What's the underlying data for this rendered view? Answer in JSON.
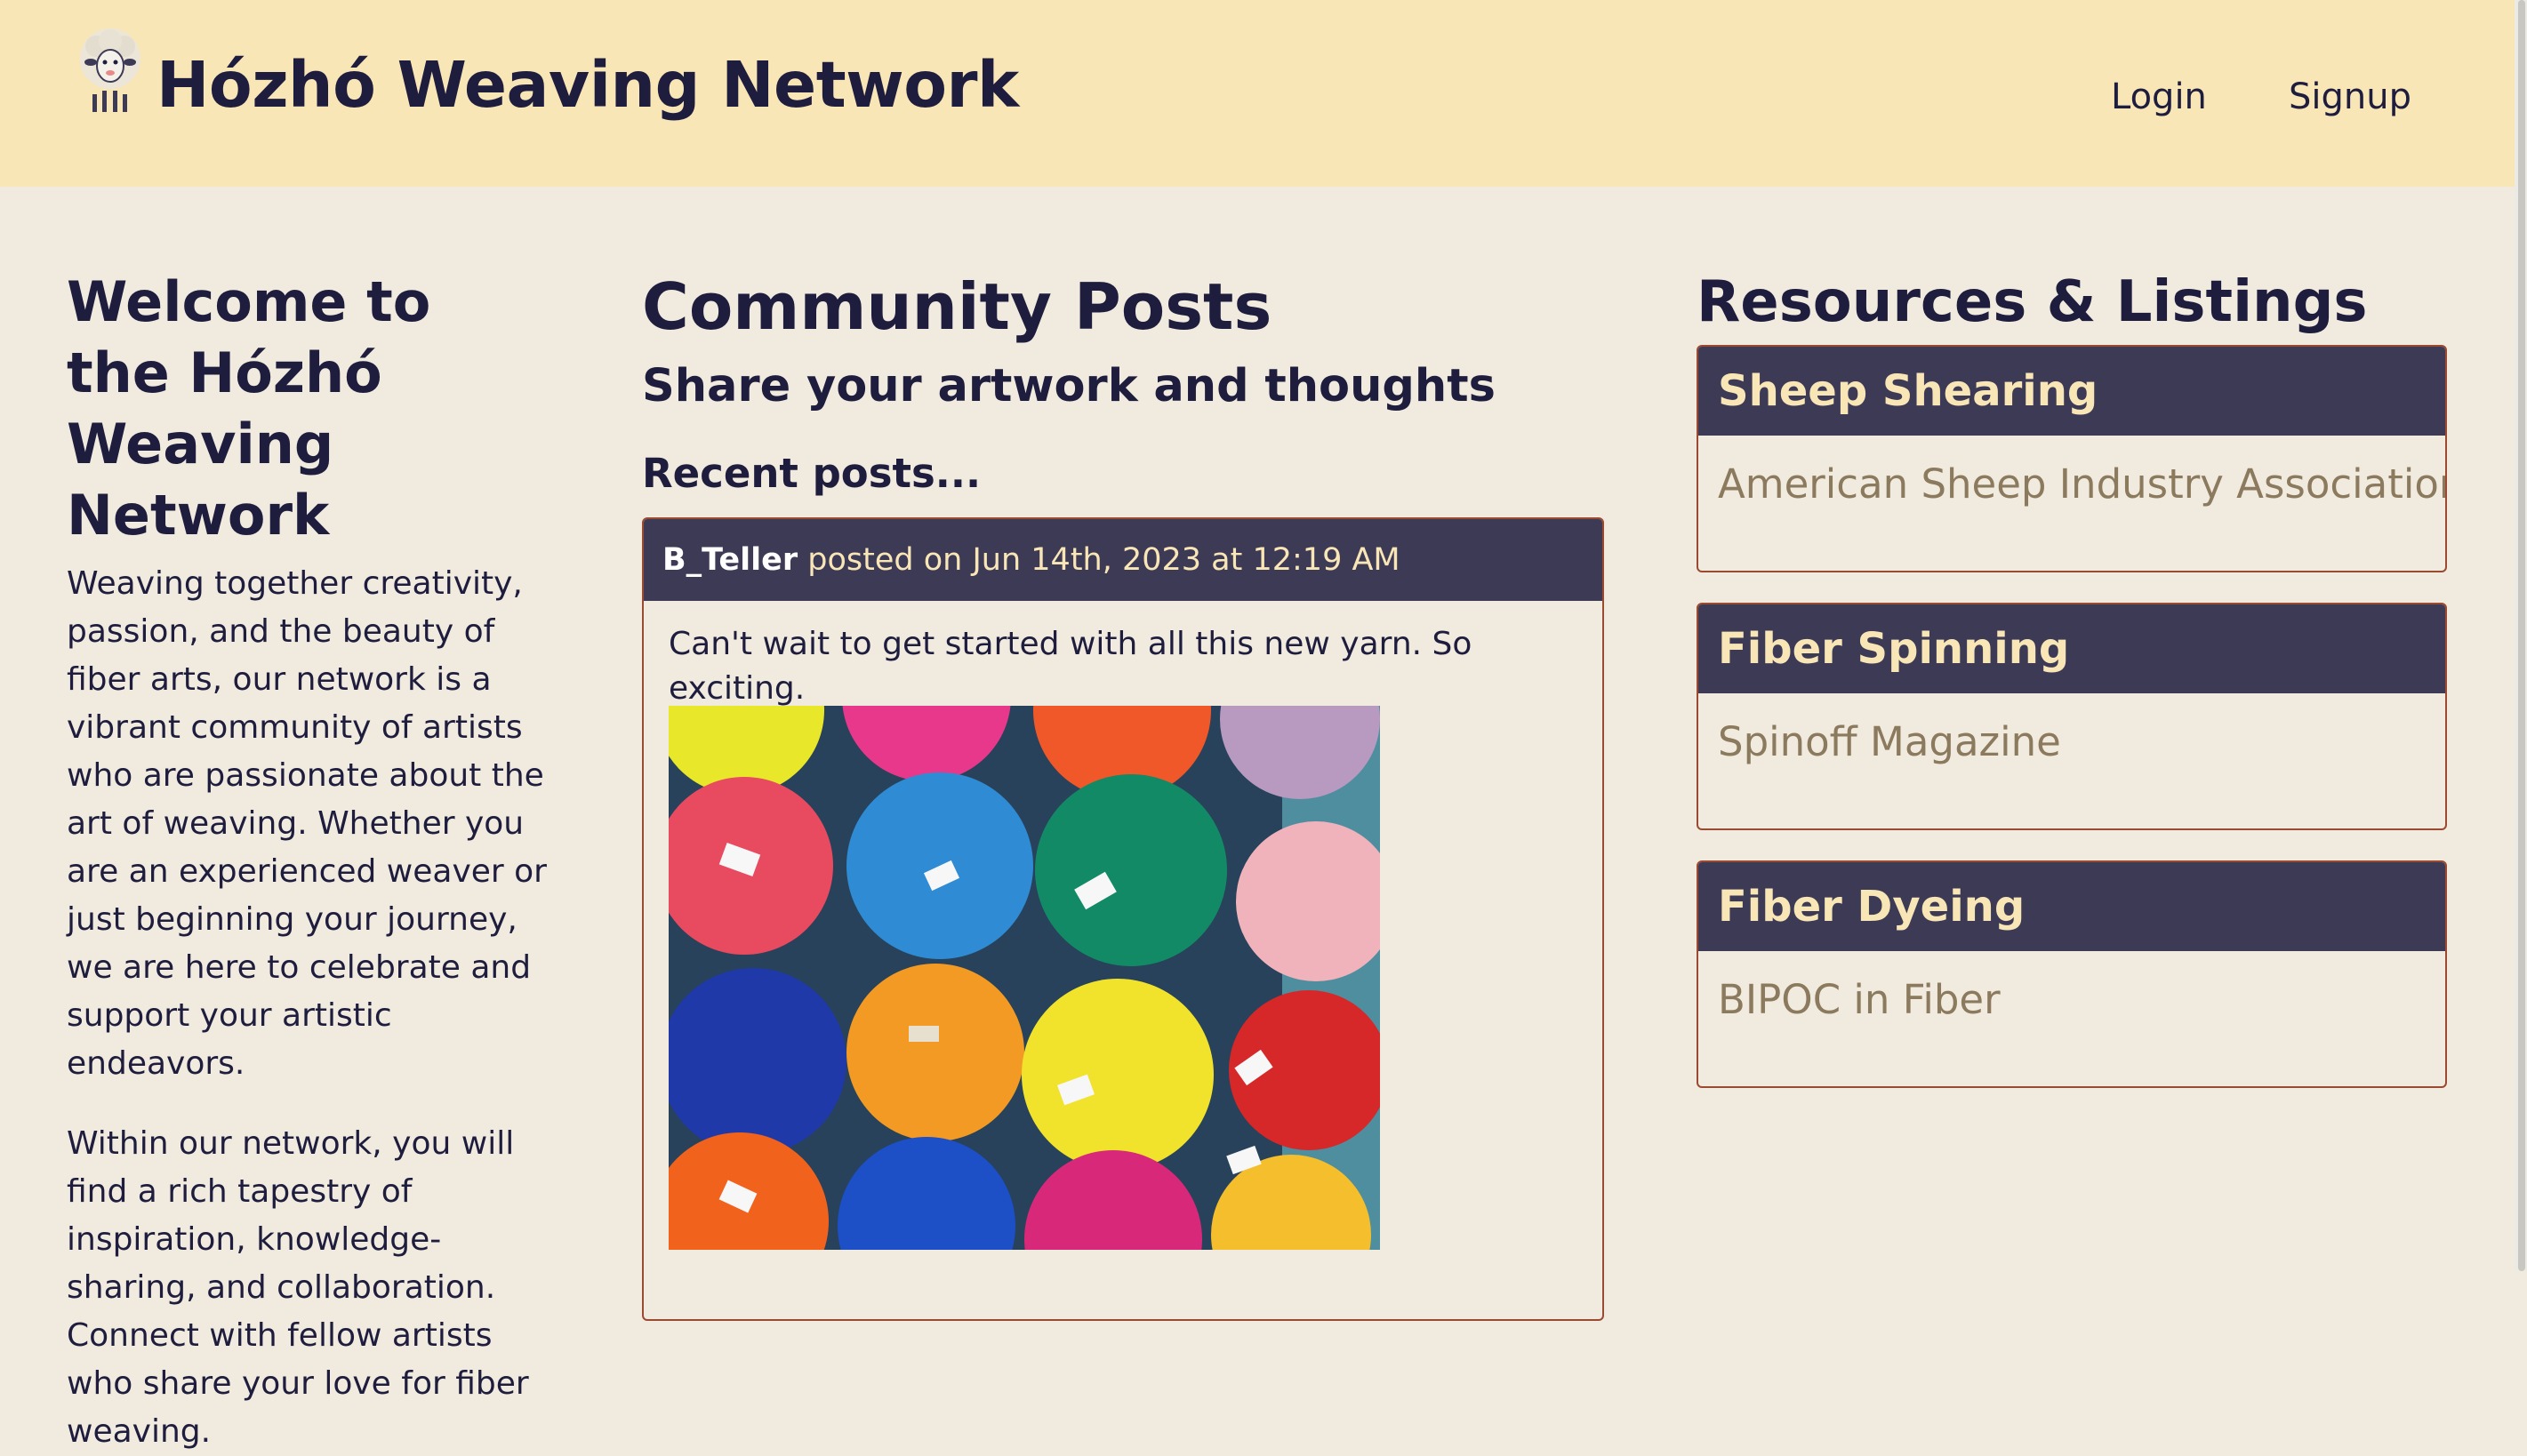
{
  "header": {
    "site_title": "Hózhó Weaving Network",
    "nav": {
      "login": "Login",
      "signup": "Signup"
    }
  },
  "welcome": {
    "title": "Welcome to the Hózhó Weaving Network",
    "paragraphs": [
      "Weaving together creativity, passion, and the beauty of fiber arts, our network is a vibrant community of artists who are passionate about the art of weaving. Whether you are an experienced weaver or just beginning your journey, we are here to celebrate and support your artistic endeavors.",
      "Within our network, you will find a rich tapestry of inspiration, knowledge-sharing, and collaboration. Connect with fellow artists who share your love for fiber weaving."
    ]
  },
  "community": {
    "title": "Community Posts",
    "subtitle": "Share your artwork and thoughts",
    "recent_label": "Recent posts...",
    "posts": [
      {
        "author": "B_Teller",
        "meta": "posted on Jun 14th, 2023 at 12:19 AM",
        "text": "Can't wait to get started with all this new yarn. So exciting."
      }
    ]
  },
  "resources": {
    "title": "Resources & Listings",
    "items": [
      {
        "category": "Sheep Shearing",
        "link": "American Sheep Industry Association"
      },
      {
        "category": "Fiber Spinning",
        "link": "Spinoff Magazine"
      },
      {
        "category": "Fiber Dyeing",
        "link": "BIPOC in Fiber"
      }
    ]
  },
  "colors": {
    "header_bg": "#f9e6b7",
    "page_bg": "#f1ebdf",
    "card_header_bg": "#3d3a56",
    "card_border": "#9a4a30",
    "text": "#1f1d3e",
    "link": "#8b7a5e"
  },
  "icons": {
    "logo": "sheep-logo-icon",
    "post_image": "colorful-wool-roving-photo"
  }
}
